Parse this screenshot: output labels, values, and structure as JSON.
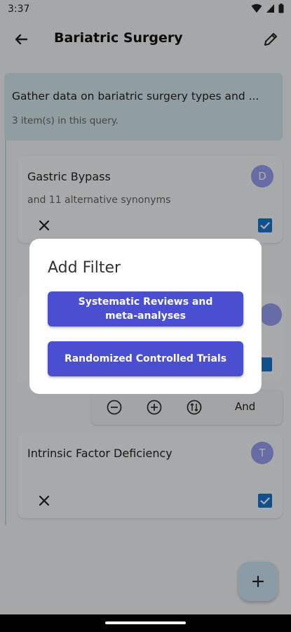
{
  "status_bar": {
    "time": "3:37"
  },
  "app_bar": {
    "title": "Bariatric Surgery"
  },
  "query": {
    "title": "Gather data on bariatric surgery types and ...",
    "count_text": "3 item(s) in this query."
  },
  "items": [
    {
      "title": "Gastric Bypass",
      "subtitle": "and 11 alternative synonyms",
      "avatar": "D",
      "checked": true
    },
    {
      "title": "Intrinsic Factor Deficiency",
      "subtitle": "",
      "avatar": "T",
      "checked": true
    }
  ],
  "operator_bar": {
    "operator_label": "And"
  },
  "dialog": {
    "title": "Add Filter",
    "buttons": [
      "Systematic Reviews and meta-analyses",
      "Randomized Controlled Trials"
    ]
  },
  "colors": {
    "accent": "#4a4fd1",
    "checkbox": "#1976d2",
    "query_bg": "#d4e8ee",
    "avatar": "#9a9ff2"
  }
}
